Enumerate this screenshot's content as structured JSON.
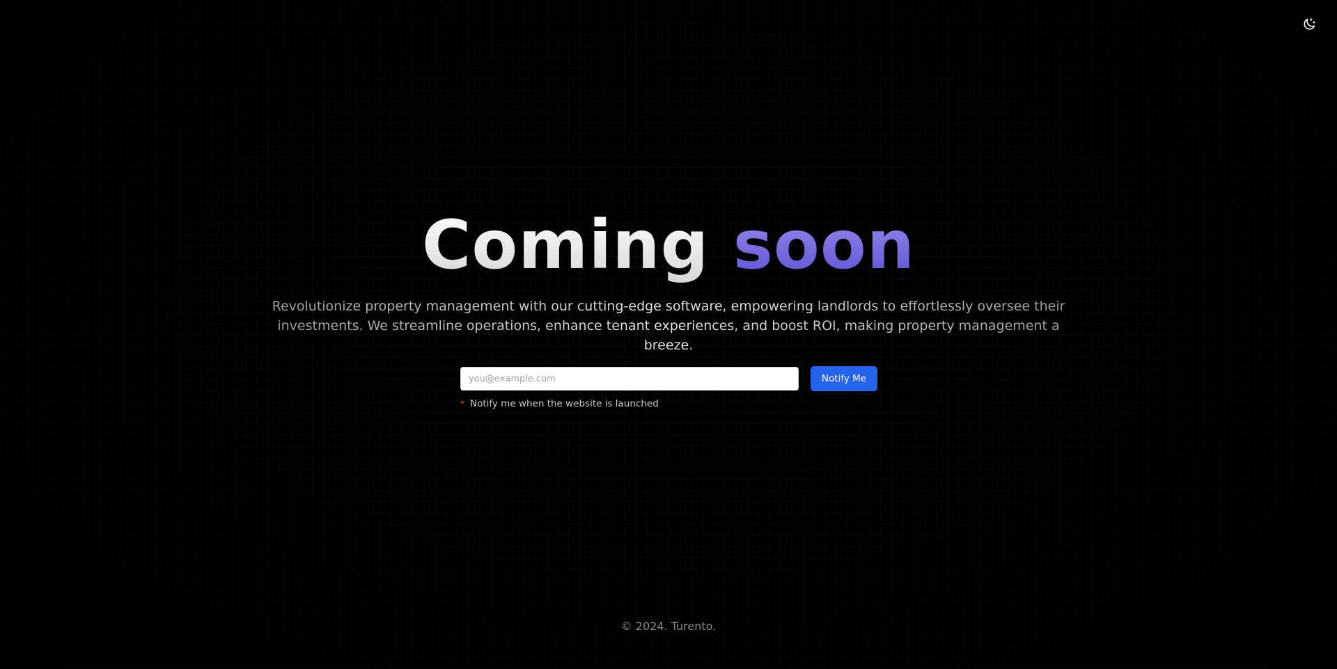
{
  "header": {
    "theme_toggle_icon": "moon-stars-icon"
  },
  "hero": {
    "headline_part1": "Coming",
    "headline_part2": "soon",
    "subtitle": "Revolutionize property management with our cutting-edge software, empowering landlords to effortlessly oversee their investments. We streamline operations, enhance tenant experiences, and boost ROI, making property management a breeze."
  },
  "notify_form": {
    "email_placeholder": "you@example.com",
    "email_value": "",
    "button_label": "Notify Me",
    "hint_marker": "*",
    "hint_text": "Notify me when the website is launched"
  },
  "footer": {
    "copyright": "© 2024. Turento."
  },
  "colors": {
    "background": "#000000",
    "accent_button": "#2563eb",
    "headline_accent": "#7b70e6",
    "hint_marker": "#e0563e"
  }
}
